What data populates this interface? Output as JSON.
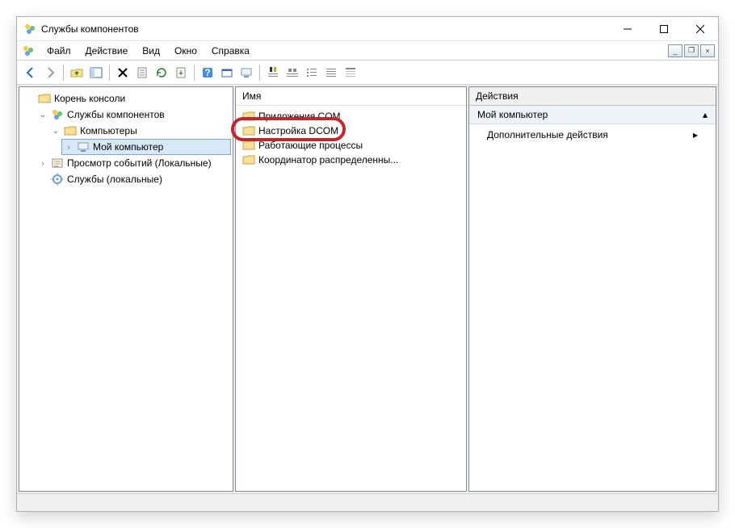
{
  "window": {
    "title": "Службы компонентов"
  },
  "menu": {
    "file": "Файл",
    "action": "Действие",
    "view": "Вид",
    "window": "Окно",
    "help": "Справка"
  },
  "tree": {
    "root": "Корень консоли",
    "comp_services": "Службы компонентов",
    "computers": "Компьютеры",
    "my_computer": "Мой компьютер",
    "event_viewer": "Просмотр событий (Локальные)",
    "services_local": "Службы (локальные)"
  },
  "list": {
    "col_name": "Имя",
    "com_apps": "Приложения COM",
    "dcom": "Настройка DCOM",
    "processes": "Работающие процессы",
    "dtc": "Координатор распределенны..."
  },
  "actions": {
    "header": "Действия",
    "section_title": "Мой компьютер",
    "more": "Дополнительные действия"
  }
}
